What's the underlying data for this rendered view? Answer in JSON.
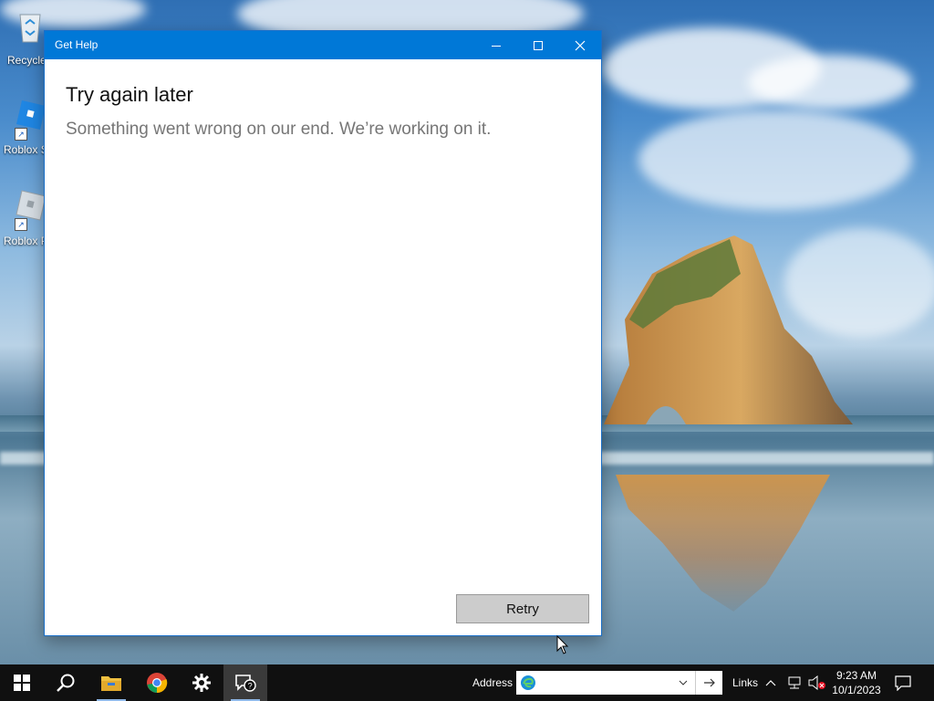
{
  "desktop": {
    "icons": [
      {
        "label": "Recycle",
        "icon": "recycle-bin-icon"
      },
      {
        "label": "Roblox S",
        "icon": "roblox-studio-icon"
      },
      {
        "label": "Roblox P",
        "icon": "roblox-player-icon"
      }
    ]
  },
  "window": {
    "title": "Get Help",
    "controls": {
      "minimize": "minimize-icon",
      "maximize": "maximize-icon",
      "close": "close-icon"
    },
    "heading": "Try again later",
    "message": "Something went wrong on our end. We’re working on it.",
    "retry_label": "Retry"
  },
  "taskbar": {
    "items": [
      {
        "name": "start",
        "icon": "windows-logo-icon"
      },
      {
        "name": "search",
        "icon": "search-icon"
      },
      {
        "name": "file-explorer",
        "icon": "folder-icon"
      },
      {
        "name": "chrome",
        "icon": "chrome-icon"
      },
      {
        "name": "settings",
        "icon": "gear-icon"
      },
      {
        "name": "get-help",
        "icon": "help-chat-icon",
        "active": true
      }
    ],
    "address_label": "Address",
    "address_value": "",
    "links_label": "Links",
    "clock_time": "9:23 AM",
    "clock_date": "10/1/2023"
  },
  "colors": {
    "titlebar": "#0078d7",
    "taskbar": "#101010",
    "retry_button": "#cccccc"
  }
}
